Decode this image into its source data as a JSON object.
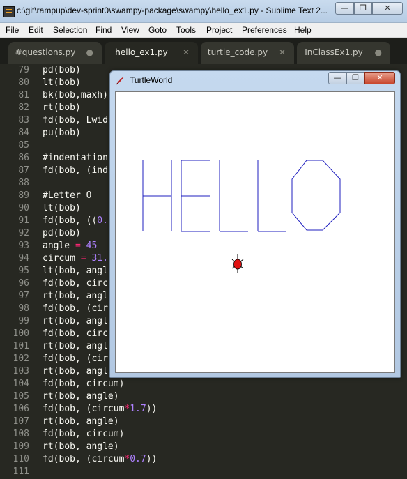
{
  "window": {
    "title": "c:\\git\\rampup\\dev-sprint0\\swampy-package\\swampy\\hello_ex1.py - Sublime Text 2...",
    "min_glyph": "—",
    "max_glyph": "❐",
    "close_glyph": "✕"
  },
  "menu": [
    "File",
    "Edit",
    "Selection",
    "Find",
    "View",
    "Goto",
    "Tools",
    "Project",
    "Preferences",
    "Help"
  ],
  "tabs": [
    {
      "label": "#questions.py",
      "status": "●",
      "active": false
    },
    {
      "label": "hello_ex1.py",
      "status": "✕",
      "active": true
    },
    {
      "label": "turtle_code.py",
      "status": "✕",
      "active": false
    },
    {
      "label": "InClassEx1.py",
      "status": "●",
      "active": false
    }
  ],
  "code_lines": [
    {
      "n": "79",
      "t": "pd(bob)"
    },
    {
      "n": "80",
      "t": "lt(bob)"
    },
    {
      "n": "81",
      "t": "bk(bob,maxh)"
    },
    {
      "n": "82",
      "t": "rt(bob)"
    },
    {
      "n": "83",
      "t": "fd(bob, Lwid"
    },
    {
      "n": "84",
      "t": "pu(bob)"
    },
    {
      "n": "85",
      "t": ""
    },
    {
      "n": "86",
      "t": "#indentation",
      "c": "cm"
    },
    {
      "n": "87",
      "t": "fd(bob, (ind"
    },
    {
      "n": "88",
      "t": ""
    },
    {
      "n": "89",
      "t": "#Letter O",
      "c": "cm"
    },
    {
      "n": "90",
      "t": "lt(bob)"
    },
    {
      "n": "91",
      "t": "fd(bob, ((0."
    },
    {
      "n": "92",
      "t": "pd(bob)"
    },
    {
      "n": "93",
      "t": "angle = 45"
    },
    {
      "n": "94",
      "t": "circum = 31."
    },
    {
      "n": "95",
      "t": "lt(bob, angl"
    },
    {
      "n": "96",
      "t": "fd(bob, circ"
    },
    {
      "n": "97",
      "t": "rt(bob, angl"
    },
    {
      "n": "98",
      "t": "fd(bob, (cir"
    },
    {
      "n": "99",
      "t": "rt(bob, angl"
    },
    {
      "n": "100",
      "t": "fd(bob, circ"
    },
    {
      "n": "101",
      "t": "rt(bob, angl"
    },
    {
      "n": "102",
      "t": "fd(bob, (cir"
    },
    {
      "n": "103",
      "t": "rt(bob, angl"
    },
    {
      "n": "104",
      "t": "fd(bob, circum)"
    },
    {
      "n": "105",
      "t": "rt(bob, angle)"
    },
    {
      "n": "106",
      "t": "fd(bob, (circum*1.7))"
    },
    {
      "n": "107",
      "t": "rt(bob, angle)"
    },
    {
      "n": "108",
      "t": "fd(bob, circum)"
    },
    {
      "n": "109",
      "t": "rt(bob, angle)"
    },
    {
      "n": "110",
      "t": "fd(bob, (circum*0.7))"
    },
    {
      "n": "111",
      "t": ""
    }
  ],
  "turtle_window": {
    "title": "TurtleWorld",
    "min_glyph": "—",
    "max_glyph": "❐",
    "close_glyph": "✕",
    "pen_color": "#1f1fbf",
    "turtle_color": "#e01010"
  }
}
